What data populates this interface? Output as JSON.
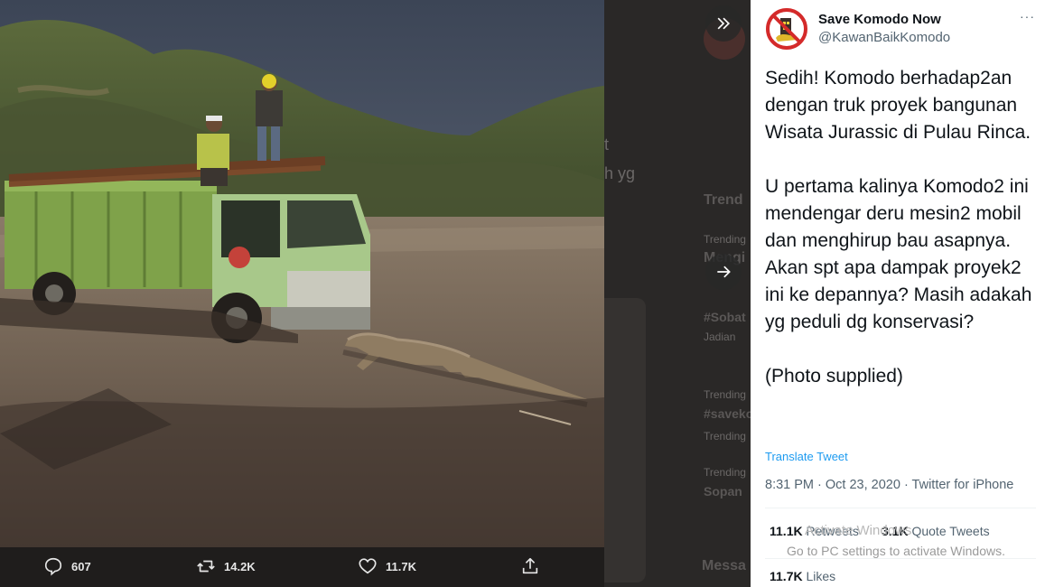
{
  "background": {
    "ghost_texts": [
      "t",
      "h yg",
      "Trend",
      "Trending",
      "Mengi",
      "#Sobat",
      "Jadian",
      "Trending",
      "#saveko",
      "Trending",
      "Trending",
      "Sopan",
      "Messa"
    ]
  },
  "photo": {
    "description_icon": "komodo-truck-photo"
  },
  "actions": {
    "reply_count": "607",
    "retweet_count": "14.2K",
    "like_count": "11.7K"
  },
  "nav": {
    "collapse_icon": "double-chevron-right-icon",
    "next_icon": "arrow-right-icon"
  },
  "tweet": {
    "display_name": "Save Komodo Now",
    "handle": "@KawanBaikKomodo",
    "more": "···",
    "text": "Sedih! Komodo berhadap2an dengan truk proyek bangunan Wisata Jurassic di Pulau Rinca.\n\nU pertama kalinya Komodo2 ini mendengar deru mesin2 mobil dan menghirup bau asapnya. Akan spt apa dampak proyek2 ini ke depannya? Masih adakah yg peduli dg konservasi?\n\n(Photo supplied)",
    "translate_label": "Translate Tweet",
    "meta": "8:31 PM · Oct 23, 2020 · Twitter for iPhone",
    "retweets_value": "11.1K",
    "retweets_label": "Retweets",
    "quotes_value": "3.1K",
    "quotes_label": "Quote Tweets",
    "likes_value": "11.7K",
    "likes_label": "Likes"
  },
  "watermark": {
    "line1": "Activate Windows",
    "line2": "Go to PC settings to activate Windows."
  },
  "colors": {
    "accent": "#1d9bf0",
    "panel_bg": "#ffffff",
    "overlay_bg": "#1f1d1c"
  }
}
